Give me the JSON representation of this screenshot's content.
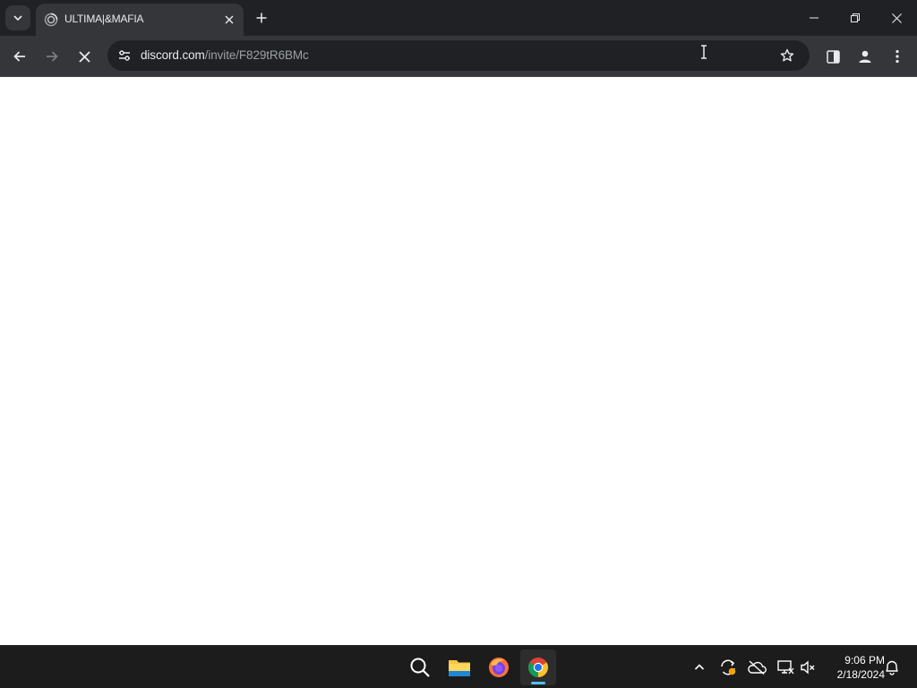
{
  "browser": {
    "tab": {
      "title": "ULTIMA|&MAFIA",
      "favicon": "discord-loading-icon"
    },
    "address_bar": {
      "host": "discord.com",
      "path": "/invite/F829tR6BMc"
    },
    "icons": {
      "tab_search": "chevron-down-icon",
      "tab_close": "close-icon",
      "new_tab": "plus-icon",
      "minimize": "minimize-icon",
      "restore": "restore-icon",
      "close": "close-icon",
      "back": "arrow-left-icon",
      "forward": "arrow-right-icon",
      "stop": "stop-loading-icon",
      "site_info": "tune-icon",
      "bookmark": "star-icon",
      "side_panel": "side-panel-icon",
      "profile": "profile-icon",
      "menu": "kebab-menu-icon"
    }
  },
  "taskbar": {
    "apps": [
      {
        "name": "Search",
        "icon": "search-icon"
      },
      {
        "name": "File Explorer",
        "icon": "folder-icon"
      },
      {
        "name": "Firefox",
        "icon": "firefox-icon"
      },
      {
        "name": "Google Chrome",
        "icon": "chrome-icon",
        "active": true
      }
    ],
    "tray": [
      "chevron-up-icon",
      "sync-icon",
      "onedrive-offline-icon",
      "network-icon",
      "volume-muted-icon"
    ],
    "clock": {
      "time": "9:06 PM",
      "date": "2/18/2024"
    },
    "notification_icon": "bell-icon"
  },
  "colors": {
    "titlebar": "#202124",
    "toolbar": "#35363a",
    "omnibox": "#202124",
    "taskbar": "#1c1c1c",
    "accent": "#4cc2ff"
  }
}
